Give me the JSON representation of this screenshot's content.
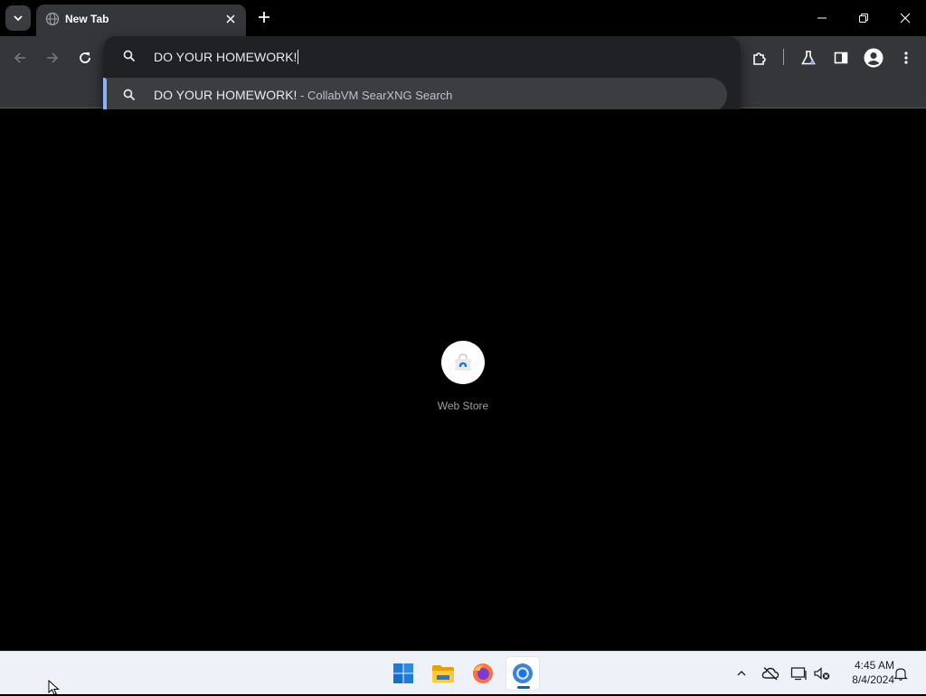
{
  "browser": {
    "tab": {
      "title": "New Tab"
    },
    "omnibox": {
      "input_value": "DO YOUR HOMEWORK!",
      "suggestion": {
        "query": "DO YOUR HOMEWORK!",
        "separator": " - ",
        "source": "CollabVM SearXNG Search"
      }
    },
    "accent_color": "#8ab4f8"
  },
  "new_tab_page": {
    "shortcuts": [
      {
        "label": "Web Store",
        "icon": "web-store-icon"
      }
    ]
  },
  "taskbar": {
    "apps": [
      {
        "name": "start",
        "icon": "windows-logo-icon"
      },
      {
        "name": "file-explorer",
        "icon": "folder-icon"
      },
      {
        "name": "firefox",
        "icon": "firefox-icon"
      },
      {
        "name": "chrome",
        "icon": "chrome-icon",
        "active": true
      }
    ],
    "clock": {
      "time": "4:45 AM",
      "date": "8/4/2024"
    }
  }
}
